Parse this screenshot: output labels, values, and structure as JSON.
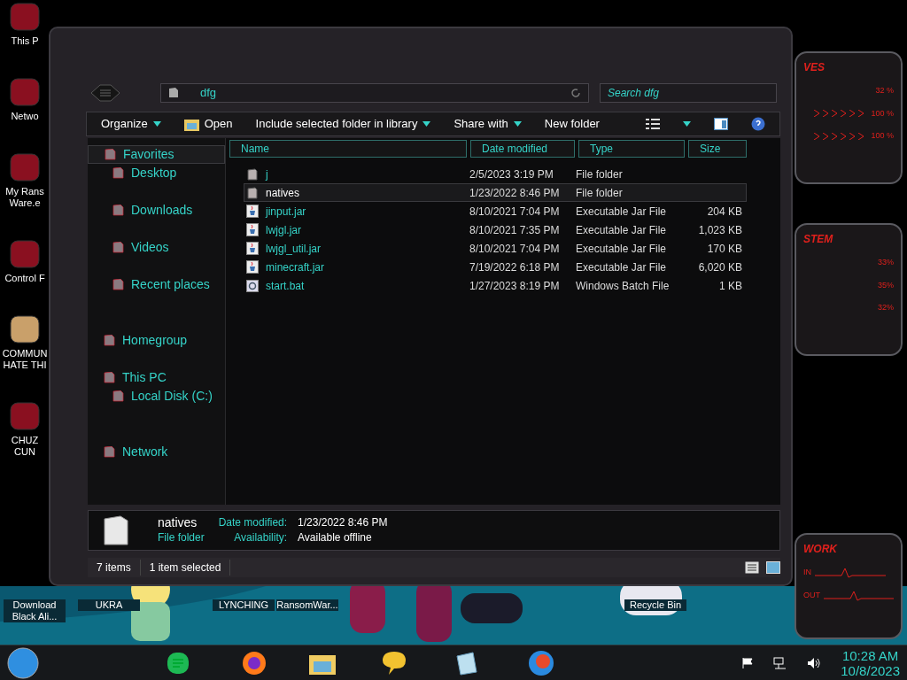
{
  "desktop_icons": [
    {
      "label": "This P"
    },
    {
      "label": "Netwo"
    },
    {
      "label": "My Rans Ware.e"
    },
    {
      "label": "Control F"
    },
    {
      "label": "COMMUN HATE THI"
    },
    {
      "label": "CHUZ CUN"
    }
  ],
  "bottom_icons": [
    {
      "label": "Download Black Ali..."
    },
    {
      "label": "UKRA"
    },
    {
      "label": "LYNCHING"
    },
    {
      "label": "RansomWar..."
    },
    {
      "label": "Recycle Bin"
    }
  ],
  "gadgets": [
    {
      "title": "VES",
      "readings": [
        "32 %",
        "100 %",
        "100 %"
      ]
    },
    {
      "title": "STEM",
      "readings": [
        "33%",
        "35%",
        "32%"
      ]
    },
    {
      "title": "WORK",
      "readings": [
        "IN",
        "OUT"
      ]
    }
  ],
  "window": {
    "address": "dfg",
    "search": {
      "placeholder": "Search dfg"
    },
    "toolbar": [
      {
        "label": "Organize",
        "dropdown": true,
        "icon": false
      },
      {
        "label": "Open",
        "dropdown": false,
        "icon": true
      },
      {
        "label": "Include selected folder in library",
        "dropdown": true,
        "icon": false
      },
      {
        "label": "Share with",
        "dropdown": true,
        "icon": false
      },
      {
        "label": "New folder",
        "dropdown": false,
        "icon": false
      }
    ],
    "nav": [
      {
        "label": "Favorites",
        "selected": true,
        "children": [
          {
            "label": "Desktop",
            "selected": false
          },
          {
            "label": "Downloads",
            "selected": false
          },
          {
            "label": "Videos",
            "selected": false
          },
          {
            "label": "Recent places",
            "selected": false
          }
        ]
      },
      {
        "label": "Homegroup",
        "selected": false
      },
      {
        "label": "This PC",
        "selected": false,
        "children": [
          {
            "label": "Local Disk (C:)",
            "selected": false
          }
        ]
      },
      {
        "label": "Network",
        "selected": false
      }
    ],
    "columns": [
      "Name",
      "Date modified",
      "Type",
      "Size"
    ],
    "rows": [
      {
        "kind": "folder",
        "name": "j",
        "date": "2/5/2023 3:19 PM",
        "type": "File folder",
        "size": "",
        "selected": false
      },
      {
        "kind": "folder",
        "name": "natives",
        "date": "1/23/2022 8:46 PM",
        "type": "File folder",
        "selected": true
      },
      {
        "kind": "jar",
        "name": "jinput.jar",
        "date": "8/10/2021 7:04 PM",
        "type": "Executable Jar File",
        "size": "204 KB",
        "selected": false
      },
      {
        "kind": "jar",
        "name": "lwjgl.jar",
        "date": "8/10/2021 7:35 PM",
        "type": "Executable Jar File",
        "size": "1,023 KB",
        "selected": false
      },
      {
        "kind": "jar",
        "name": "lwjgl_util.jar",
        "date": "8/10/2021 7:04 PM",
        "type": "Executable Jar File",
        "size": "170 KB",
        "selected": false
      },
      {
        "kind": "jar",
        "name": "minecraft.jar",
        "date": "7/19/2022 6:18 PM",
        "type": "Executable Jar File",
        "size": "6,020 KB",
        "selected": false
      },
      {
        "kind": "bat",
        "name": "start.bat",
        "date": "1/27/2023 8:19 PM",
        "type": "Windows Batch File",
        "size": "1 KB",
        "selected": false
      }
    ],
    "details": {
      "name": "natives",
      "type": "File folder",
      "fields": [
        {
          "label": "Date modified:",
          "value": "1/23/2022 8:46 PM"
        },
        {
          "label": "Availability:",
          "value": "Available offline"
        }
      ]
    },
    "status": [
      "7 items",
      "1 item selected"
    ]
  },
  "taskbar": {
    "time": "10:28 AM",
    "date": "10/8/2023"
  }
}
